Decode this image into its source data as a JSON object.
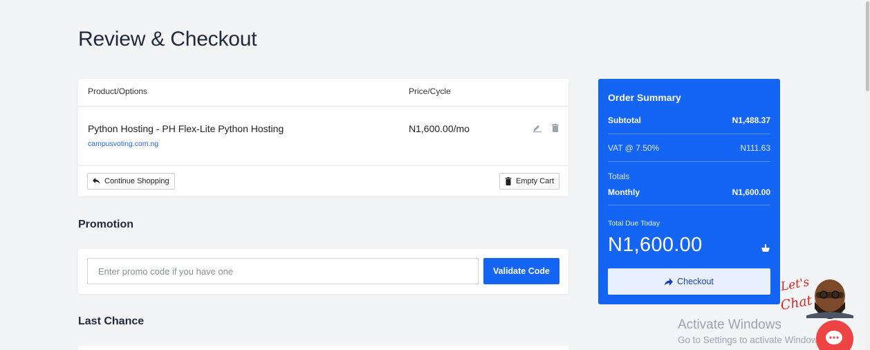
{
  "page": {
    "title": "Review & Checkout"
  },
  "cart": {
    "headers": {
      "product": "Product/Options",
      "price": "Price/Cycle"
    },
    "item": {
      "name": "Python Hosting - PH Flex-Lite Python Hosting",
      "domain": "campusvoting.com.ng",
      "price": "N1,600.00/mo",
      "edit_icon": "pencil-icon",
      "delete_icon": "trash-icon"
    },
    "continue_label": "Continue Shopping",
    "empty_label": "Empty Cart"
  },
  "promotion": {
    "title": "Promotion",
    "placeholder": "Enter promo code if you have one",
    "validate_label": "Validate Code"
  },
  "last_chance": {
    "title": "Last Chance"
  },
  "summary": {
    "title": "Order Summary",
    "subtotal_label": "Subtotal",
    "subtotal_value": "N1,488.37",
    "vat_label": "VAT @ 7.50%",
    "vat_value": "N111.63",
    "totals_label": "Totals",
    "monthly_label": "Monthly",
    "monthly_value": "N1,600.00",
    "due_label": "Total Due Today",
    "due_amount": "N1,600.00",
    "checkout_label": "Checkout"
  },
  "watermark": {
    "title": "Activate Windows",
    "subtitle": "Go to Settings to activate Windows."
  },
  "chat": {
    "label": "Let's Chat"
  },
  "colors": {
    "accent": "#1565f5",
    "background": "#f3f4f6"
  }
}
